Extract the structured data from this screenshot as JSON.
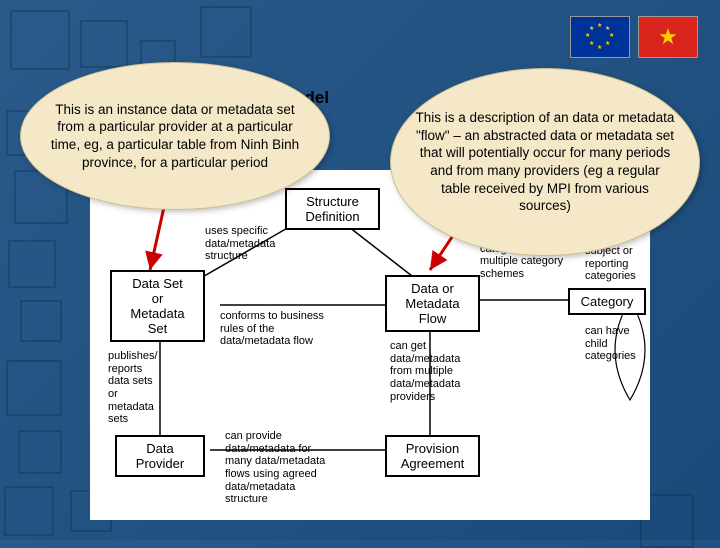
{
  "title": "Model",
  "flags": {
    "eu": "EU flag",
    "vn": "Vietnam flag"
  },
  "bubbles": {
    "left": "This is an instance data or metadata set from a particular provider at a particular time, eg, a particular table from Ninh Binh province, for a particular period",
    "right": "This is a description of an data or metadata \"flow\" – an abstracted data or metadata set that will potentially occur for many periods and from many providers (eg a regular table received by MPI from various sources)"
  },
  "boxes": {
    "structure_def": "Structure\nDefinition",
    "dataset": "Data Set\nor\nMetadata\nSet",
    "flow": "Data or\nMetadata\nFlow",
    "category": "Category",
    "provider": "Data\nProvider",
    "provision": "Provision\nAgreement"
  },
  "labels": {
    "uses_structure": "uses specific\ndata/metadata\nstructure",
    "conforms": "conforms to business\nrules of the\ndata/metadata flow",
    "publishes": "publishes/\nreports\ndata sets\nor\nmetadata\nsets",
    "can_provide": "can provide\ndata/metadata for\nmany data/metadata\nflows using agreed\ndata/metadata\nstructure",
    "can_get": "can get\ndata/metadata\nfrom multiple\ndata/metadata\nproviders",
    "linked_categories": "can be linked to\ncategories in\nmultiple category\nschemes",
    "reporting": "subject or\nreporting\ncategories",
    "child": "can have\nchild\ncategories"
  }
}
